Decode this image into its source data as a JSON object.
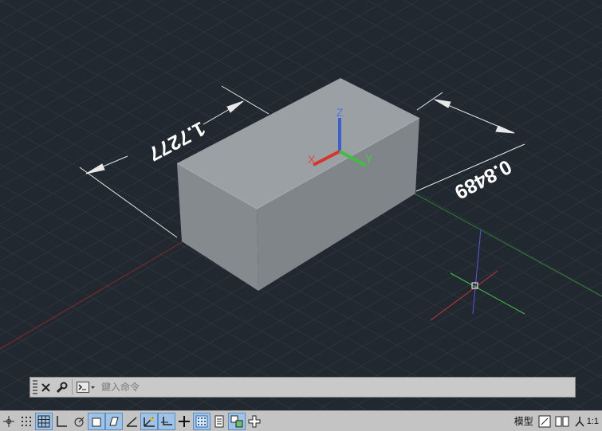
{
  "viewport": {
    "dimensions": {
      "length_label": "1.7277",
      "depth_label": "0.8489"
    },
    "ucs_icon": {
      "x": "X",
      "y": "Y",
      "z": "Z"
    },
    "colors": {
      "background": "#212830",
      "box_top": "#9aa0a3",
      "box_front": "#878d90",
      "box_right": "#80868a",
      "axis_red": "#d9342c",
      "axis_green": "#3fbf3f",
      "axis_blue": "#4a6de0"
    }
  },
  "command_line": {
    "placeholder": "鍵入命令",
    "close_icon": "close-icon",
    "settings_icon": "wrench-icon",
    "prompt_icon": "command-prompt-icon"
  },
  "status_bar": {
    "model_label": "模型",
    "scale_label": "1:1",
    "buttons": [
      "grid-snap",
      "snap-mode",
      "grid-display",
      "ortho",
      "polar",
      "object-snap",
      "3d-osnap",
      "object-tracking",
      "dynamic-ucs",
      "dynamic-input",
      "lineweight",
      "transparency",
      "quick-properties",
      "selection-cycling",
      "annotation-monitor"
    ]
  }
}
